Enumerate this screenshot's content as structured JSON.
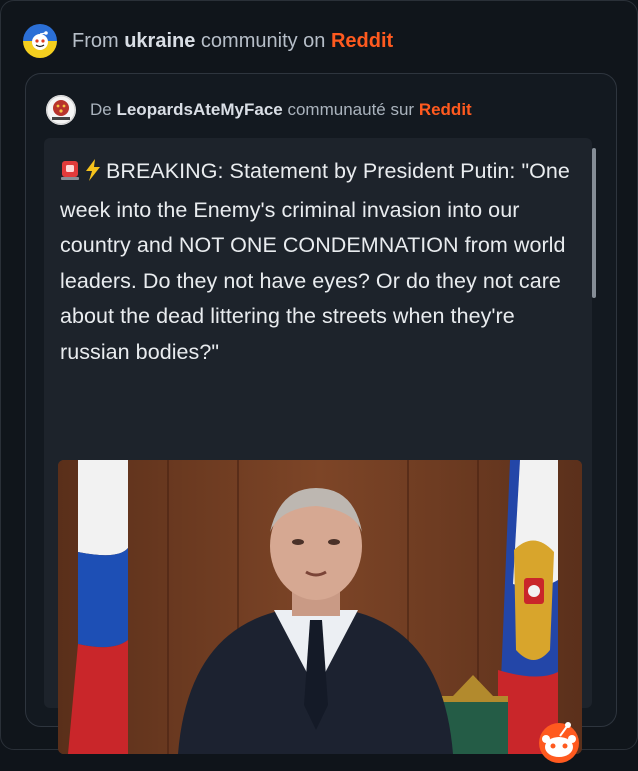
{
  "outer": {
    "prefix": "From ",
    "community": "ukraine",
    "middle": " community on ",
    "brand": "Reddit"
  },
  "inner": {
    "prefix": "De ",
    "community": "LeopardsAteMyFace",
    "middle": " communauté sur ",
    "brand": "Reddit"
  },
  "post": {
    "text": "BREAKING: Statement by President Putin: \"One week into the Enemy's criminal invasion into our country and NOT ONE CONDEMNATION from world leaders. Do they not have eyes? Or do they not care about the dead littering the streets when they're russian bodies?\"",
    "icons": [
      "rotating-light-icon",
      "lightning-icon"
    ]
  },
  "colors": {
    "brand": "#ff5a1f",
    "background": "#10151b",
    "card": "#1d232b"
  }
}
